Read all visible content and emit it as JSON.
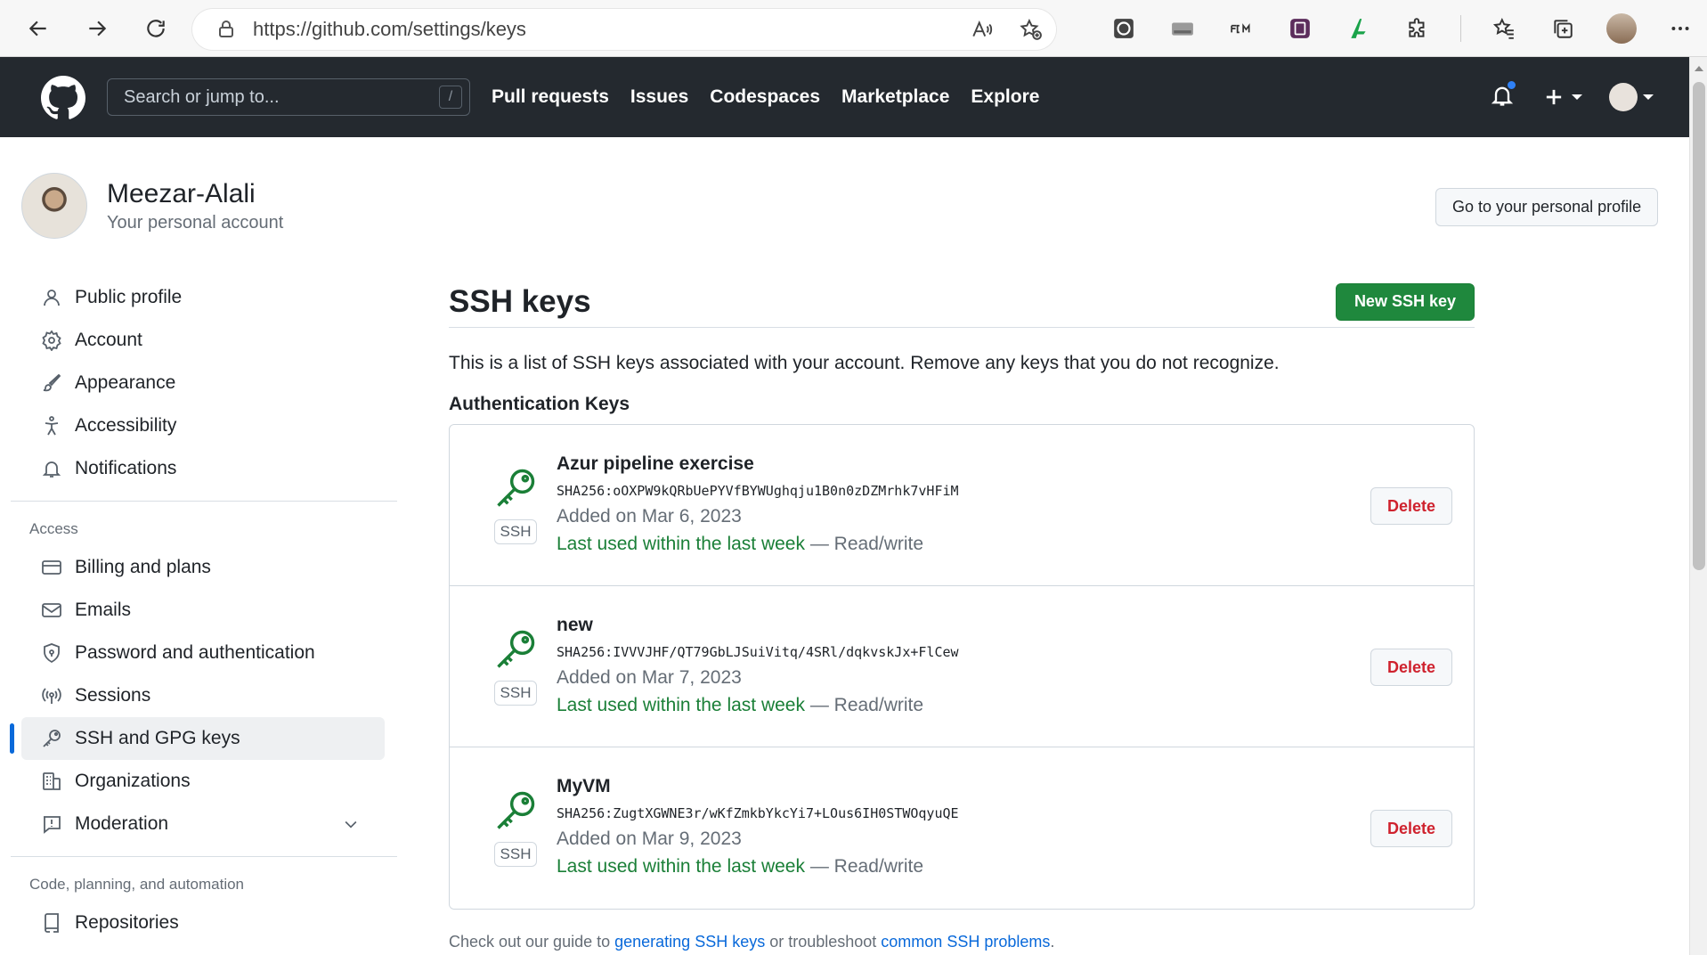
{
  "browser": {
    "url": "https://github.com/settings/keys"
  },
  "header": {
    "search_placeholder": "Search or jump to...",
    "search_shortcut": "/",
    "nav": [
      "Pull requests",
      "Issues",
      "Codespaces",
      "Marketplace",
      "Explore"
    ]
  },
  "profile": {
    "name": "Meezar-Alali",
    "subtitle": "Your personal account",
    "go_profile_label": "Go to your personal profile"
  },
  "sidebar": {
    "items_top": [
      {
        "label": "Public profile",
        "icon": "person-icon"
      },
      {
        "label": "Account",
        "icon": "gear-icon"
      },
      {
        "label": "Appearance",
        "icon": "paintbrush-icon"
      },
      {
        "label": "Accessibility",
        "icon": "accessibility-icon"
      },
      {
        "label": "Notifications",
        "icon": "bell-icon"
      }
    ],
    "access_heading": "Access",
    "items_access": [
      {
        "label": "Billing and plans",
        "icon": "credit-card-icon"
      },
      {
        "label": "Emails",
        "icon": "mail-icon"
      },
      {
        "label": "Password and authentication",
        "icon": "shield-lock-icon"
      },
      {
        "label": "Sessions",
        "icon": "broadcast-icon"
      },
      {
        "label": "SSH and GPG keys",
        "icon": "key-icon",
        "active": true
      },
      {
        "label": "Organizations",
        "icon": "organization-icon"
      },
      {
        "label": "Moderation",
        "icon": "report-icon"
      }
    ],
    "code_heading": "Code, planning, and automation",
    "items_code": [
      {
        "label": "Repositories",
        "icon": "repo-icon"
      }
    ]
  },
  "main": {
    "title": "SSH keys",
    "new_key_label": "New SSH key",
    "description": "This is a list of SSH keys associated with your account. Remove any keys that you do not recognize.",
    "auth_heading": "Authentication Keys",
    "badge": "SSH",
    "delete_label": "Delete",
    "keys": [
      {
        "title": "Azur pipeline exercise",
        "fingerprint": "SHA256:oOXPW9kQRbUePYVfBYWUghqju1B0n0zDZMrhk7vHFiM",
        "added": "Added on Mar 6, 2023",
        "last_used": "Last used within the last week",
        "access": " — Read/write"
      },
      {
        "title": "new",
        "fingerprint": "SHA256:IVVVJHF/QT79GbLJSuiVitq/4SRl/dqkvskJx+FlCew",
        "added": "Added on Mar 7, 2023",
        "last_used": "Last used within the last week",
        "access": " — Read/write"
      },
      {
        "title": "MyVM",
        "fingerprint": "SHA256:ZugtXGWNE3r/wKfZmkbYkcYi7+LOus6IH0STWOqyuQE",
        "added": "Added on Mar 9, 2023",
        "last_used": "Last used within the last week",
        "access": " — Read/write"
      }
    ],
    "footer": {
      "prefix": "Check out our guide to ",
      "link1": "generating SSH keys",
      "middle": " or troubleshoot ",
      "link2": "common SSH problems",
      "suffix": "."
    }
  }
}
